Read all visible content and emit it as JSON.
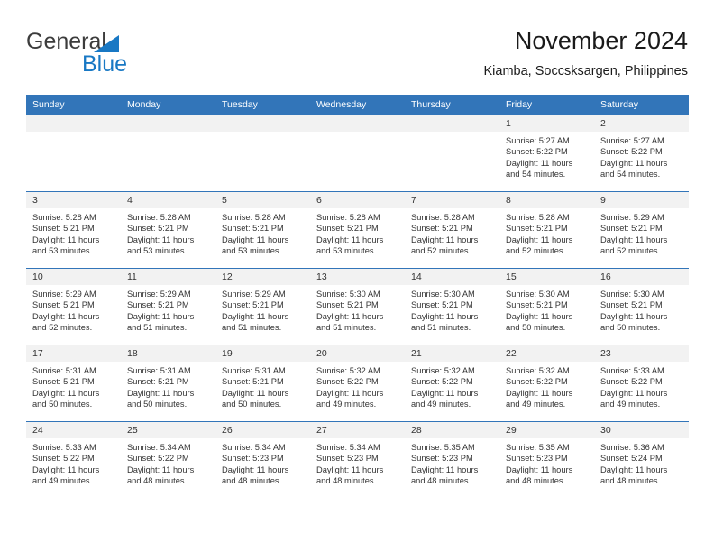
{
  "brand": {
    "word1": "General",
    "word2": "Blue",
    "triangle_color": "#1878c4",
    "text_color": "#3c3c3c"
  },
  "header": {
    "title": "November 2024",
    "subtitle": "Kiamba, Soccsksargen, Philippines"
  },
  "theme": {
    "header_blue": "#3275b9",
    "daynum_bg": "#f2f2f2",
    "text": "#333333"
  },
  "weekday_headers": [
    "Sunday",
    "Monday",
    "Tuesday",
    "Wednesday",
    "Thursday",
    "Friday",
    "Saturday"
  ],
  "weeks": [
    [
      {
        "day": "",
        "empty": true
      },
      {
        "day": "",
        "empty": true
      },
      {
        "day": "",
        "empty": true
      },
      {
        "day": "",
        "empty": true
      },
      {
        "day": "",
        "empty": true
      },
      {
        "day": "1",
        "sunrise": "Sunrise: 5:27 AM",
        "sunset": "Sunset: 5:22 PM",
        "daylight": "Daylight: 11 hours and 54 minutes."
      },
      {
        "day": "2",
        "sunrise": "Sunrise: 5:27 AM",
        "sunset": "Sunset: 5:22 PM",
        "daylight": "Daylight: 11 hours and 54 minutes."
      }
    ],
    [
      {
        "day": "3",
        "sunrise": "Sunrise: 5:28 AM",
        "sunset": "Sunset: 5:21 PM",
        "daylight": "Daylight: 11 hours and 53 minutes."
      },
      {
        "day": "4",
        "sunrise": "Sunrise: 5:28 AM",
        "sunset": "Sunset: 5:21 PM",
        "daylight": "Daylight: 11 hours and 53 minutes."
      },
      {
        "day": "5",
        "sunrise": "Sunrise: 5:28 AM",
        "sunset": "Sunset: 5:21 PM",
        "daylight": "Daylight: 11 hours and 53 minutes."
      },
      {
        "day": "6",
        "sunrise": "Sunrise: 5:28 AM",
        "sunset": "Sunset: 5:21 PM",
        "daylight": "Daylight: 11 hours and 53 minutes."
      },
      {
        "day": "7",
        "sunrise": "Sunrise: 5:28 AM",
        "sunset": "Sunset: 5:21 PM",
        "daylight": "Daylight: 11 hours and 52 minutes."
      },
      {
        "day": "8",
        "sunrise": "Sunrise: 5:28 AM",
        "sunset": "Sunset: 5:21 PM",
        "daylight": "Daylight: 11 hours and 52 minutes."
      },
      {
        "day": "9",
        "sunrise": "Sunrise: 5:29 AM",
        "sunset": "Sunset: 5:21 PM",
        "daylight": "Daylight: 11 hours and 52 minutes."
      }
    ],
    [
      {
        "day": "10",
        "sunrise": "Sunrise: 5:29 AM",
        "sunset": "Sunset: 5:21 PM",
        "daylight": "Daylight: 11 hours and 52 minutes."
      },
      {
        "day": "11",
        "sunrise": "Sunrise: 5:29 AM",
        "sunset": "Sunset: 5:21 PM",
        "daylight": "Daylight: 11 hours and 51 minutes."
      },
      {
        "day": "12",
        "sunrise": "Sunrise: 5:29 AM",
        "sunset": "Sunset: 5:21 PM",
        "daylight": "Daylight: 11 hours and 51 minutes."
      },
      {
        "day": "13",
        "sunrise": "Sunrise: 5:30 AM",
        "sunset": "Sunset: 5:21 PM",
        "daylight": "Daylight: 11 hours and 51 minutes."
      },
      {
        "day": "14",
        "sunrise": "Sunrise: 5:30 AM",
        "sunset": "Sunset: 5:21 PM",
        "daylight": "Daylight: 11 hours and 51 minutes."
      },
      {
        "day": "15",
        "sunrise": "Sunrise: 5:30 AM",
        "sunset": "Sunset: 5:21 PM",
        "daylight": "Daylight: 11 hours and 50 minutes."
      },
      {
        "day": "16",
        "sunrise": "Sunrise: 5:30 AM",
        "sunset": "Sunset: 5:21 PM",
        "daylight": "Daylight: 11 hours and 50 minutes."
      }
    ],
    [
      {
        "day": "17",
        "sunrise": "Sunrise: 5:31 AM",
        "sunset": "Sunset: 5:21 PM",
        "daylight": "Daylight: 11 hours and 50 minutes."
      },
      {
        "day": "18",
        "sunrise": "Sunrise: 5:31 AM",
        "sunset": "Sunset: 5:21 PM",
        "daylight": "Daylight: 11 hours and 50 minutes."
      },
      {
        "day": "19",
        "sunrise": "Sunrise: 5:31 AM",
        "sunset": "Sunset: 5:21 PM",
        "daylight": "Daylight: 11 hours and 50 minutes."
      },
      {
        "day": "20",
        "sunrise": "Sunrise: 5:32 AM",
        "sunset": "Sunset: 5:22 PM",
        "daylight": "Daylight: 11 hours and 49 minutes."
      },
      {
        "day": "21",
        "sunrise": "Sunrise: 5:32 AM",
        "sunset": "Sunset: 5:22 PM",
        "daylight": "Daylight: 11 hours and 49 minutes."
      },
      {
        "day": "22",
        "sunrise": "Sunrise: 5:32 AM",
        "sunset": "Sunset: 5:22 PM",
        "daylight": "Daylight: 11 hours and 49 minutes."
      },
      {
        "day": "23",
        "sunrise": "Sunrise: 5:33 AM",
        "sunset": "Sunset: 5:22 PM",
        "daylight": "Daylight: 11 hours and 49 minutes."
      }
    ],
    [
      {
        "day": "24",
        "sunrise": "Sunrise: 5:33 AM",
        "sunset": "Sunset: 5:22 PM",
        "daylight": "Daylight: 11 hours and 49 minutes."
      },
      {
        "day": "25",
        "sunrise": "Sunrise: 5:34 AM",
        "sunset": "Sunset: 5:22 PM",
        "daylight": "Daylight: 11 hours and 48 minutes."
      },
      {
        "day": "26",
        "sunrise": "Sunrise: 5:34 AM",
        "sunset": "Sunset: 5:23 PM",
        "daylight": "Daylight: 11 hours and 48 minutes."
      },
      {
        "day": "27",
        "sunrise": "Sunrise: 5:34 AM",
        "sunset": "Sunset: 5:23 PM",
        "daylight": "Daylight: 11 hours and 48 minutes."
      },
      {
        "day": "28",
        "sunrise": "Sunrise: 5:35 AM",
        "sunset": "Sunset: 5:23 PM",
        "daylight": "Daylight: 11 hours and 48 minutes."
      },
      {
        "day": "29",
        "sunrise": "Sunrise: 5:35 AM",
        "sunset": "Sunset: 5:23 PM",
        "daylight": "Daylight: 11 hours and 48 minutes."
      },
      {
        "day": "30",
        "sunrise": "Sunrise: 5:36 AM",
        "sunset": "Sunset: 5:24 PM",
        "daylight": "Daylight: 11 hours and 48 minutes."
      }
    ]
  ]
}
